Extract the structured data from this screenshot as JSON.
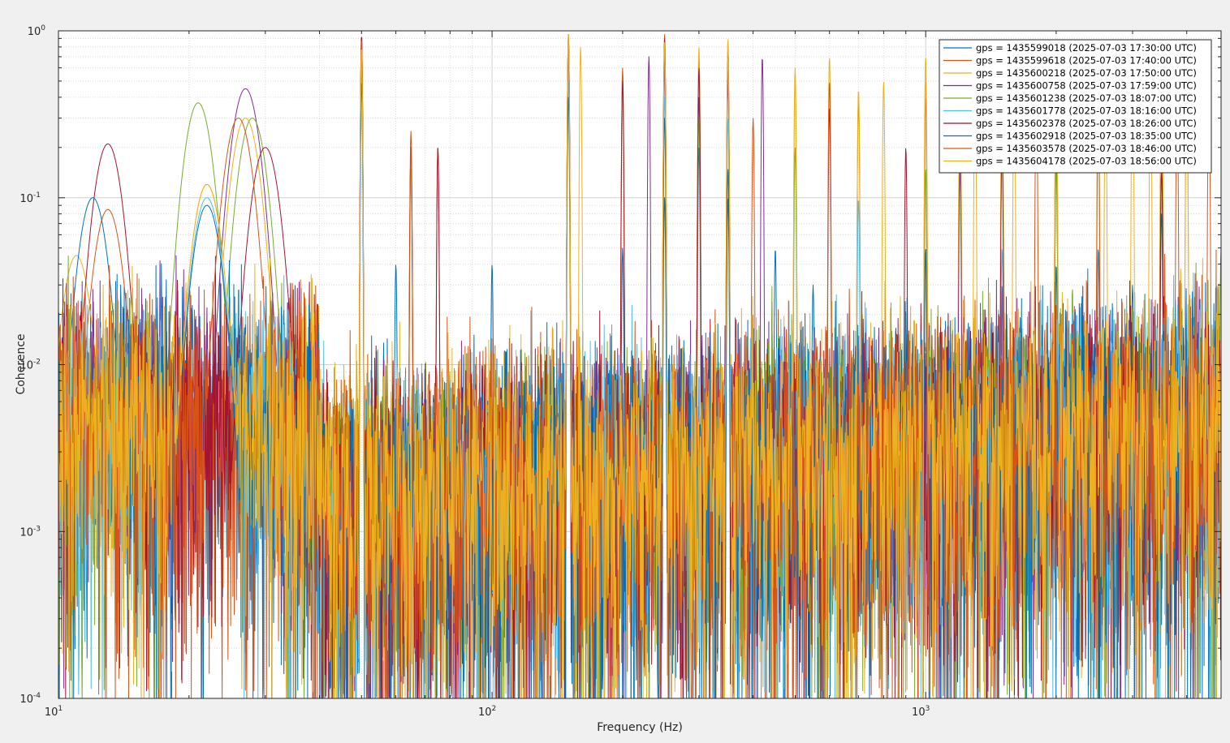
{
  "chart_data": {
    "type": "line",
    "title": "",
    "xlabel": "Frequency (Hz)",
    "ylabel": "Coherence",
    "xscale": "log",
    "yscale": "log",
    "xlim": [
      10,
      4800
    ],
    "ylim": [
      0.0001,
      1
    ],
    "grid": true,
    "minor_grid": true,
    "legend_position": "top-right",
    "x_ticks": [
      {
        "value": 10,
        "base": "10",
        "exp": "1"
      },
      {
        "value": 100,
        "base": "10",
        "exp": "2"
      },
      {
        "value": 1000,
        "base": "10",
        "exp": "3"
      }
    ],
    "y_ticks": [
      {
        "value": 0.0001,
        "base": "10",
        "exp": "-4"
      },
      {
        "value": 0.001,
        "base": "10",
        "exp": "-3"
      },
      {
        "value": 0.01,
        "base": "10",
        "exp": "-2"
      },
      {
        "value": 0.1,
        "base": "10",
        "exp": "-1"
      },
      {
        "value": 1,
        "base": "10",
        "exp": "0"
      }
    ],
    "series": [
      {
        "name": "gps = 1435599018 (2025-07-03 17:30:00 UTC)",
        "color": "#0072BD",
        "peaks": [
          [
            50,
            0.55
          ],
          [
            60,
            0.04
          ],
          [
            100,
            0.04
          ],
          [
            150,
            0.9
          ],
          [
            200,
            0.05
          ],
          [
            250,
            0.1
          ],
          [
            300,
            0.2
          ],
          [
            350,
            0.1
          ],
          [
            450,
            0.05
          ],
          [
            550,
            0.03
          ],
          [
            1000,
            0.05
          ],
          [
            1500,
            0.03
          ],
          [
            2000,
            0.04
          ],
          [
            3000,
            0.03
          ],
          [
            3500,
            0.08
          ]
        ]
      },
      {
        "name": "gps = 1435599618 (2025-07-03 17:40:00 UTC)",
        "color": "#D95319",
        "peaks": [
          [
            13,
            0.085
          ],
          [
            50,
            0.95
          ],
          [
            65,
            0.25
          ],
          [
            75,
            0.2
          ],
          [
            150,
            0.95
          ],
          [
            200,
            0.6
          ],
          [
            250,
            0.95
          ],
          [
            300,
            0.7
          ],
          [
            350,
            0.8
          ],
          [
            400,
            0.3
          ],
          [
            700,
            0.4
          ],
          [
            1200,
            0.3
          ],
          [
            2000,
            0.5
          ],
          [
            3500,
            0.6
          ],
          [
            4500,
            0.5
          ]
        ]
      },
      {
        "name": "gps = 1435600218 (2025-07-03 17:50:00 UTC)",
        "color": "#EDB120",
        "peaks": [
          [
            11,
            0.045
          ],
          [
            22,
            0.12
          ],
          [
            27,
            0.3
          ],
          [
            50,
            0.7
          ],
          [
            65,
            0.15
          ],
          [
            150,
            0.85
          ],
          [
            160,
            0.8
          ],
          [
            200,
            0.5
          ],
          [
            250,
            0.9
          ],
          [
            300,
            0.8
          ],
          [
            350,
            0.9
          ],
          [
            500,
            0.6
          ],
          [
            600,
            0.7
          ],
          [
            800,
            0.5
          ],
          [
            1000,
            0.7
          ],
          [
            1200,
            0.5
          ],
          [
            1500,
            0.5
          ],
          [
            2000,
            0.6
          ],
          [
            2500,
            0.5
          ],
          [
            3000,
            0.7
          ],
          [
            3500,
            0.8
          ],
          [
            4000,
            0.6
          ]
        ]
      },
      {
        "name": "gps = 1435600758 (2025-07-03 17:59:00 UTC)",
        "color": "#7E2F8E",
        "peaks": [
          [
            27,
            0.45
          ],
          [
            50,
            0.8
          ],
          [
            150,
            0.7
          ],
          [
            230,
            0.7
          ],
          [
            250,
            0.6
          ],
          [
            300,
            0.4
          ],
          [
            350,
            0.5
          ],
          [
            420,
            0.7
          ],
          [
            1200,
            0.15
          ],
          [
            2000,
            0.2
          ],
          [
            3500,
            0.15
          ]
        ]
      },
      {
        "name": "gps = 1435601238 (2025-07-03 18:07:00 UTC)",
        "color": "#77AC30",
        "peaks": [
          [
            21,
            0.37
          ],
          [
            28,
            0.3
          ],
          [
            50,
            0.9
          ],
          [
            150,
            0.8
          ],
          [
            250,
            0.7
          ],
          [
            300,
            0.3
          ],
          [
            350,
            0.6
          ],
          [
            500,
            0.2
          ],
          [
            1000,
            0.15
          ],
          [
            2000,
            0.15
          ],
          [
            4800,
            0.05
          ]
        ]
      },
      {
        "name": "gps = 1435601778 (2025-07-03 18:16:00 UTC)",
        "color": "#4DBEEE",
        "peaks": [
          [
            22,
            0.1
          ],
          [
            50,
            0.6
          ],
          [
            150,
            0.5
          ],
          [
            250,
            0.4
          ],
          [
            350,
            0.3
          ],
          [
            700,
            0.1
          ],
          [
            1500,
            0.05
          ]
        ]
      },
      {
        "name": "gps = 1435602378 (2025-07-03 18:26:00 UTC)",
        "color": "#A2142F",
        "peaks": [
          [
            13,
            0.21
          ],
          [
            30,
            0.2
          ],
          [
            50,
            0.95
          ],
          [
            65,
            0.2
          ],
          [
            75,
            0.2
          ],
          [
            150,
            0.95
          ],
          [
            200,
            0.5
          ],
          [
            250,
            0.9
          ],
          [
            300,
            0.6
          ],
          [
            350,
            0.7
          ],
          [
            600,
            0.35
          ],
          [
            900,
            0.2
          ],
          [
            1500,
            0.2
          ],
          [
            3500,
            0.15
          ]
        ]
      },
      {
        "name": "gps = 1435602918 (2025-07-03 18:35:00 UTC)",
        "color": "#0072BD",
        "peaks": [
          [
            12,
            0.1
          ],
          [
            22,
            0.09
          ],
          [
            50,
            0.5
          ],
          [
            150,
            0.4
          ],
          [
            250,
            0.3
          ],
          [
            350,
            0.15
          ],
          [
            1000,
            0.05
          ],
          [
            2500,
            0.05
          ]
        ]
      },
      {
        "name": "gps = 1435603578 (2025-07-03 18:46:00 UTC)",
        "color": "#D95319",
        "peaks": [
          [
            26,
            0.3
          ],
          [
            50,
            0.9
          ],
          [
            65,
            0.2
          ],
          [
            150,
            0.9
          ],
          [
            250,
            0.8
          ],
          [
            350,
            0.6
          ],
          [
            600,
            0.5
          ],
          [
            1000,
            0.4
          ],
          [
            1800,
            0.5
          ],
          [
            2500,
            0.3
          ],
          [
            3800,
            0.4
          ]
        ]
      },
      {
        "name": "gps = 1435604178 (2025-07-03 18:56:00 UTC)",
        "color": "#EDB120",
        "peaks": [
          [
            22,
            0.12
          ],
          [
            50,
            0.8
          ],
          [
            150,
            0.95
          ],
          [
            250,
            0.85
          ],
          [
            350,
            0.7
          ],
          [
            500,
            0.5
          ],
          [
            700,
            0.45
          ],
          [
            1000,
            0.5
          ],
          [
            1300,
            0.5
          ],
          [
            1600,
            0.45
          ],
          [
            2000,
            0.5
          ],
          [
            2600,
            0.45
          ],
          [
            3300,
            0.5
          ],
          [
            4000,
            0.5
          ]
        ]
      }
    ]
  }
}
